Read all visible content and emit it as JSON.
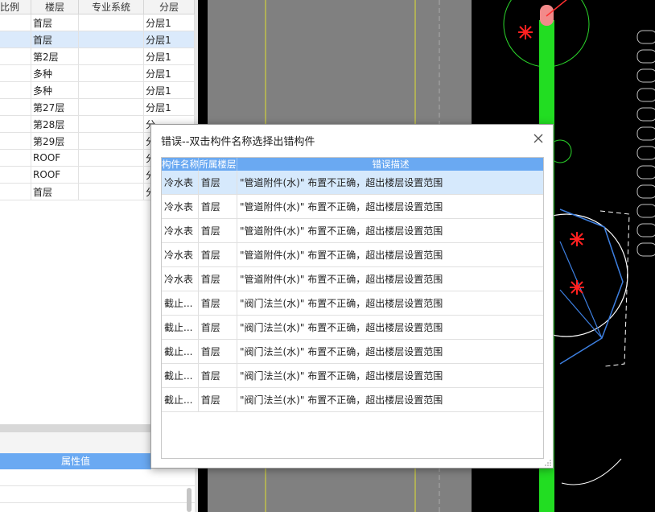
{
  "left_table": {
    "headers": [
      "比例",
      "楼层",
      "专业系统",
      "分层"
    ],
    "rows": [
      {
        "c1": "",
        "floor": "首层",
        "system": "",
        "layer": "分层1"
      },
      {
        "c1": "",
        "floor": "首层",
        "system": "",
        "layer": "分层1",
        "selected": true
      },
      {
        "c1": "",
        "floor": "第2层",
        "system": "",
        "layer": "分层1"
      },
      {
        "c1": "",
        "floor": "多种",
        "system": "",
        "layer": "分层1"
      },
      {
        "c1": "",
        "floor": "多种",
        "system": "",
        "layer": "分层1"
      },
      {
        "c1": "",
        "floor": "第27层",
        "system": "",
        "layer": "分层1"
      },
      {
        "c1": "",
        "floor": "第28层",
        "system": "",
        "layer": "分"
      },
      {
        "c1": "",
        "floor": "第29层",
        "system": "",
        "layer": "分"
      },
      {
        "c1": "",
        "floor": "ROOF",
        "system": "",
        "layer": "分"
      },
      {
        "c1": "",
        "floor": "ROOF",
        "system": "",
        "layer": "分"
      },
      {
        "c1": "",
        "floor": "首层",
        "system": "",
        "layer": "分"
      }
    ]
  },
  "properties": {
    "header": "属性值"
  },
  "dialog": {
    "title": "错误--双击构件名称选择出错构件",
    "columns": [
      "构件名称",
      "所属楼层",
      "错误描述"
    ],
    "rows": [
      {
        "name": "冷水表",
        "floor": "首层",
        "desc": "\"管道附件(水)\" 布置不正确，超出楼层设置范围",
        "selected": true
      },
      {
        "name": "冷水表",
        "floor": "首层",
        "desc": "\"管道附件(水)\" 布置不正确，超出楼层设置范围"
      },
      {
        "name": "冷水表",
        "floor": "首层",
        "desc": "\"管道附件(水)\" 布置不正确，超出楼层设置范围"
      },
      {
        "name": "冷水表",
        "floor": "首层",
        "desc": "\"管道附件(水)\" 布置不正确，超出楼层设置范围"
      },
      {
        "name": "冷水表",
        "floor": "首层",
        "desc": "\"管道附件(水)\" 布置不正确，超出楼层设置范围"
      },
      {
        "name": "截止...",
        "floor": "首层",
        "desc": "\"阀门法兰(水)\" 布置不正确，超出楼层设置范围"
      },
      {
        "name": "截止...",
        "floor": "首层",
        "desc": "\"阀门法兰(水)\" 布置不正确，超出楼层设置范围"
      },
      {
        "name": "截止...",
        "floor": "首层",
        "desc": "\"阀门法兰(水)\" 布置不正确，超出楼层设置范围"
      },
      {
        "name": "截止...",
        "floor": "首层",
        "desc": "\"阀门法兰(水)\" 布置不正确，超出楼层设置范围"
      },
      {
        "name": "截止...",
        "floor": "首层",
        "desc": "\"阀门法兰(水)\" 布置不正确，超出楼层设置范围"
      }
    ]
  },
  "colors": {
    "accent": "#6aa9f2",
    "selected_row": "#d6e9fc",
    "pipe_green": "#22dd22"
  },
  "icons": {
    "close": "close-icon",
    "resize": "resize-grip-icon"
  }
}
